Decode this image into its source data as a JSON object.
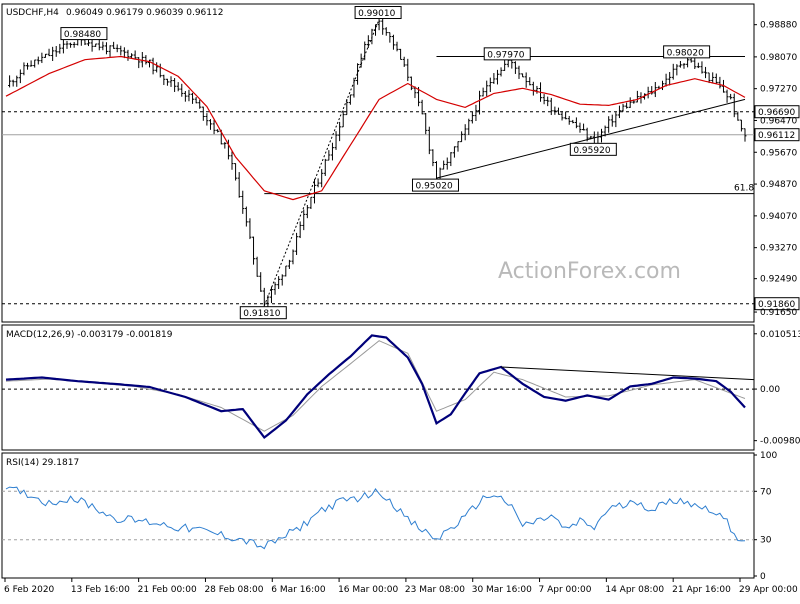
{
  "chart_data": [
    {
      "type": "candlestick",
      "title": "USDCHF,H4",
      "ohlc_header": "0.96049 0.96179 0.96039 0.96112",
      "ylim": [
        0.9145,
        0.9935
      ],
      "y_ticks": [
        "0.98880",
        "0.98070",
        "0.97270",
        "0.96470",
        "0.95670",
        "0.94870",
        "0.94070",
        "0.93270",
        "0.92490",
        "0.91650"
      ],
      "x_tick_labels": [
        "6 Feb 2020",
        "13 Feb 16:00",
        "21 Feb 00:00",
        "28 Feb 08:00",
        "6 Mar 16:00",
        "16 Mar 00:00",
        "23 Mar 08:00",
        "30 Mar 16:00",
        "7 Apr 00:00",
        "14 Apr 08:00",
        "21 Apr 16:00",
        "29 Apr 00:00"
      ],
      "price_labels": [
        "0.98480",
        "0.99010",
        "0.97970",
        "0.98020",
        "0.95020",
        "0.95920",
        "0.91810"
      ],
      "right_labels": [
        "0.96690",
        "0.96112",
        "0.91860"
      ],
      "fib_label": "61.8",
      "levels": {
        "dotted_upper": 0.9669,
        "current": 0.96112,
        "fib_618": 0.9463,
        "dotted_lower": 0.9186
      },
      "close_path": [
        [
          0,
          0.9735
        ],
        [
          3,
          0.9785
        ],
        [
          6,
          0.9812
        ],
        [
          9,
          0.9842
        ],
        [
          11,
          0.9848
        ],
        [
          14,
          0.9828
        ],
        [
          17,
          0.9815
        ],
        [
          20,
          0.979
        ],
        [
          23,
          0.9742
        ],
        [
          26,
          0.97
        ],
        [
          29,
          0.9628
        ],
        [
          31,
          0.9565
        ],
        [
          33,
          0.943
        ],
        [
          35,
          0.926
        ],
        [
          36,
          0.919
        ],
        [
          38,
          0.9245
        ],
        [
          40,
          0.932
        ],
        [
          42,
          0.943
        ],
        [
          44,
          0.952
        ],
        [
          46,
          0.961
        ],
        [
          48,
          0.972
        ],
        [
          50,
          0.984
        ],
        [
          52,
          0.9901
        ],
        [
          54,
          0.984
        ],
        [
          56,
          0.976
        ],
        [
          58,
          0.966
        ],
        [
          59,
          0.958
        ],
        [
          60,
          0.9502
        ],
        [
          62,
          0.956
        ],
        [
          64,
          0.962
        ],
        [
          66,
          0.97
        ],
        [
          68,
          0.976
        ],
        [
          70,
          0.9797
        ],
        [
          72,
          0.976
        ],
        [
          74,
          0.972
        ],
        [
          76,
          0.968
        ],
        [
          78,
          0.9655
        ],
        [
          80,
          0.9625
        ],
        [
          82,
          0.9592
        ],
        [
          84,
          0.964
        ],
        [
          86,
          0.968
        ],
        [
          88,
          0.97
        ],
        [
          90,
          0.972
        ],
        [
          92,
          0.975
        ],
        [
          94,
          0.979
        ],
        [
          95,
          0.9802
        ],
        [
          97,
          0.977
        ],
        [
          99,
          0.974
        ],
        [
          101,
          0.97
        ],
        [
          102,
          0.964
        ],
        [
          103,
          0.9611
        ]
      ],
      "ma_path": [
        [
          0,
          0.9708
        ],
        [
          6,
          0.9765
        ],
        [
          11,
          0.98
        ],
        [
          16,
          0.9808
        ],
        [
          20,
          0.9795
        ],
        [
          24,
          0.9758
        ],
        [
          28,
          0.9682
        ],
        [
          32,
          0.9555
        ],
        [
          36,
          0.947
        ],
        [
          40,
          0.9448
        ],
        [
          44,
          0.947
        ],
        [
          48,
          0.9585
        ],
        [
          52,
          0.97
        ],
        [
          56,
          0.974
        ],
        [
          60,
          0.97
        ],
        [
          64,
          0.968
        ],
        [
          68,
          0.9715
        ],
        [
          72,
          0.9728
        ],
        [
          76,
          0.9712
        ],
        [
          80,
          0.9688
        ],
        [
          84,
          0.9685
        ],
        [
          88,
          0.97
        ],
        [
          92,
          0.9735
        ],
        [
          96,
          0.9752
        ],
        [
          100,
          0.9735
        ],
        [
          103,
          0.9705
        ]
      ],
      "trend_lines": [
        {
          "from": [
            36,
            0.9181
          ],
          "to": [
            52,
            0.9901
          ],
          "style": "dashed"
        },
        {
          "from": [
            60,
            0.9502
          ],
          "to": [
            103,
            0.97
          ],
          "style": "solid"
        },
        {
          "from": [
            60,
            0.9808
          ],
          "to": [
            103,
            0.9808
          ],
          "style": "solid"
        }
      ],
      "watermark": "ActionForex.com"
    },
    {
      "type": "line",
      "title": "MACD(12,26,9) -0.003179 -0.001819",
      "ylim": [
        -0.0112,
        0.0118
      ],
      "y_ticks": [
        "0.010513",
        "0.00",
        "-0.009804"
      ],
      "macd_path": [
        [
          0,
          0.0018
        ],
        [
          5,
          0.0022
        ],
        [
          10,
          0.0015
        ],
        [
          15,
          0.001
        ],
        [
          20,
          0.0004
        ],
        [
          25,
          -0.0015
        ],
        [
          30,
          -0.0042
        ],
        [
          33,
          -0.0038
        ],
        [
          36,
          -0.0092
        ],
        [
          39,
          -0.006
        ],
        [
          42,
          -0.001
        ],
        [
          45,
          0.0028
        ],
        [
          48,
          0.0062
        ],
        [
          51,
          0.0102
        ],
        [
          53,
          0.0098
        ],
        [
          56,
          0.006
        ],
        [
          58,
          0.001
        ],
        [
          60,
          -0.0065
        ],
        [
          62,
          -0.0048
        ],
        [
          64,
          -0.0008
        ],
        [
          66,
          0.003
        ],
        [
          69,
          0.0042
        ],
        [
          72,
          0.001
        ],
        [
          75,
          -0.0015
        ],
        [
          78,
          -0.0022
        ],
        [
          81,
          -0.0012
        ],
        [
          84,
          -0.002
        ],
        [
          87,
          0.0005
        ],
        [
          90,
          0.001
        ],
        [
          93,
          0.0022
        ],
        [
          96,
          0.002
        ],
        [
          99,
          0.0015
        ],
        [
          101,
          -0.0005
        ],
        [
          103,
          -0.0035
        ]
      ],
      "signal_path": [
        [
          0,
          0.0015
        ],
        [
          6,
          0.0019
        ],
        [
          12,
          0.0012
        ],
        [
          18,
          0.0005
        ],
        [
          24,
          -0.001
        ],
        [
          30,
          -0.0035
        ],
        [
          36,
          -0.008
        ],
        [
          40,
          -0.005
        ],
        [
          44,
          0.0005
        ],
        [
          48,
          0.0048
        ],
        [
          52,
          0.0092
        ],
        [
          56,
          0.0068
        ],
        [
          60,
          -0.0042
        ],
        [
          64,
          -0.002
        ],
        [
          68,
          0.0032
        ],
        [
          72,
          0.0018
        ],
        [
          78,
          -0.0015
        ],
        [
          84,
          -0.0013
        ],
        [
          90,
          0.0008
        ],
        [
          96,
          0.0018
        ],
        [
          103,
          -0.0018
        ]
      ],
      "trend_line": {
        "from": [
          69,
          0.0042
        ],
        "to": [
          103,
          0.0018
        ]
      }
    },
    {
      "type": "line",
      "title": "RSI(14) 29.1817",
      "ylim": [
        0,
        100
      ],
      "y_ticks": [
        "100",
        "70",
        "30",
        "0"
      ],
      "reference_levels": [
        70,
        30
      ],
      "rsi_path": [
        [
          0,
          72
        ],
        [
          3,
          68
        ],
        [
          6,
          60
        ],
        [
          9,
          65
        ],
        [
          12,
          58
        ],
        [
          15,
          48
        ],
        [
          18,
          46
        ],
        [
          21,
          44
        ],
        [
          24,
          40
        ],
        [
          27,
          38
        ],
        [
          30,
          34
        ],
        [
          33,
          30
        ],
        [
          36,
          24
        ],
        [
          38,
          30
        ],
        [
          41,
          40
        ],
        [
          44,
          55
        ],
        [
          47,
          62
        ],
        [
          50,
          66
        ],
        [
          52,
          70
        ],
        [
          54,
          60
        ],
        [
          56,
          46
        ],
        [
          58,
          38
        ],
        [
          60,
          30
        ],
        [
          62,
          40
        ],
        [
          64,
          48
        ],
        [
          66,
          62
        ],
        [
          68,
          68
        ],
        [
          70,
          60
        ],
        [
          72,
          42
        ],
        [
          74,
          45
        ],
        [
          76,
          50
        ],
        [
          78,
          38
        ],
        [
          80,
          45
        ],
        [
          82,
          40
        ],
        [
          84,
          56
        ],
        [
          86,
          58
        ],
        [
          88,
          62
        ],
        [
          90,
          55
        ],
        [
          92,
          60
        ],
        [
          94,
          64
        ],
        [
          96,
          58
        ],
        [
          98,
          56
        ],
        [
          100,
          48
        ],
        [
          102,
          32
        ],
        [
          103,
          29.2
        ]
      ]
    }
  ]
}
